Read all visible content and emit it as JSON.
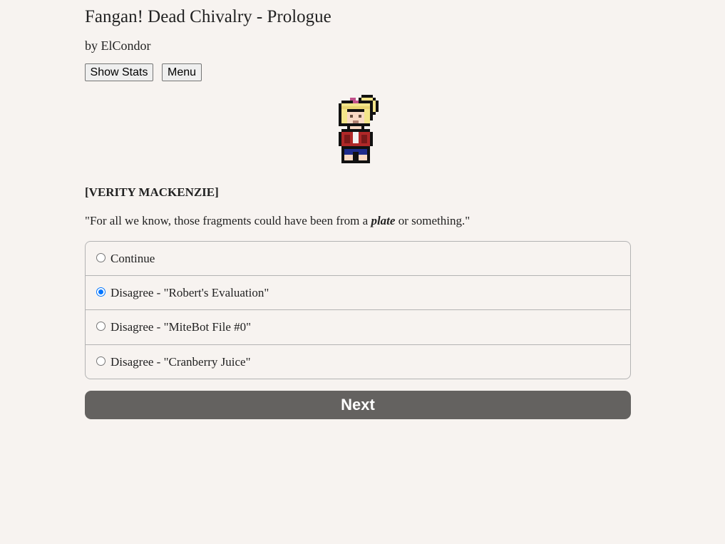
{
  "header": {
    "title": "Fangan! Dead Chivalry - Prologue",
    "author": "by ElCondor"
  },
  "toolbar": {
    "stats_label": "Show Stats",
    "menu_label": "Menu"
  },
  "scene": {
    "character_sprite": "verity-mackenzie-pixel-sprite",
    "speaker": "[VERITY MACKENZIE]",
    "dialogue_before": "\"For all we know, those fragments could have been from a ",
    "dialogue_emphasis": "plate",
    "dialogue_after": " or something.\""
  },
  "choices": [
    {
      "label": "Continue",
      "selected": false
    },
    {
      "label": "Disagree - \"Robert's Evaluation\"",
      "selected": true
    },
    {
      "label": "Disagree - \"MiteBot File #0\"",
      "selected": false
    },
    {
      "label": "Disagree - \"Cranberry Juice\"",
      "selected": false
    }
  ],
  "next_label": "Next",
  "colors": {
    "background": "#f7f3f0",
    "next_button": "#646260",
    "radio_selected": "#0075ff"
  }
}
